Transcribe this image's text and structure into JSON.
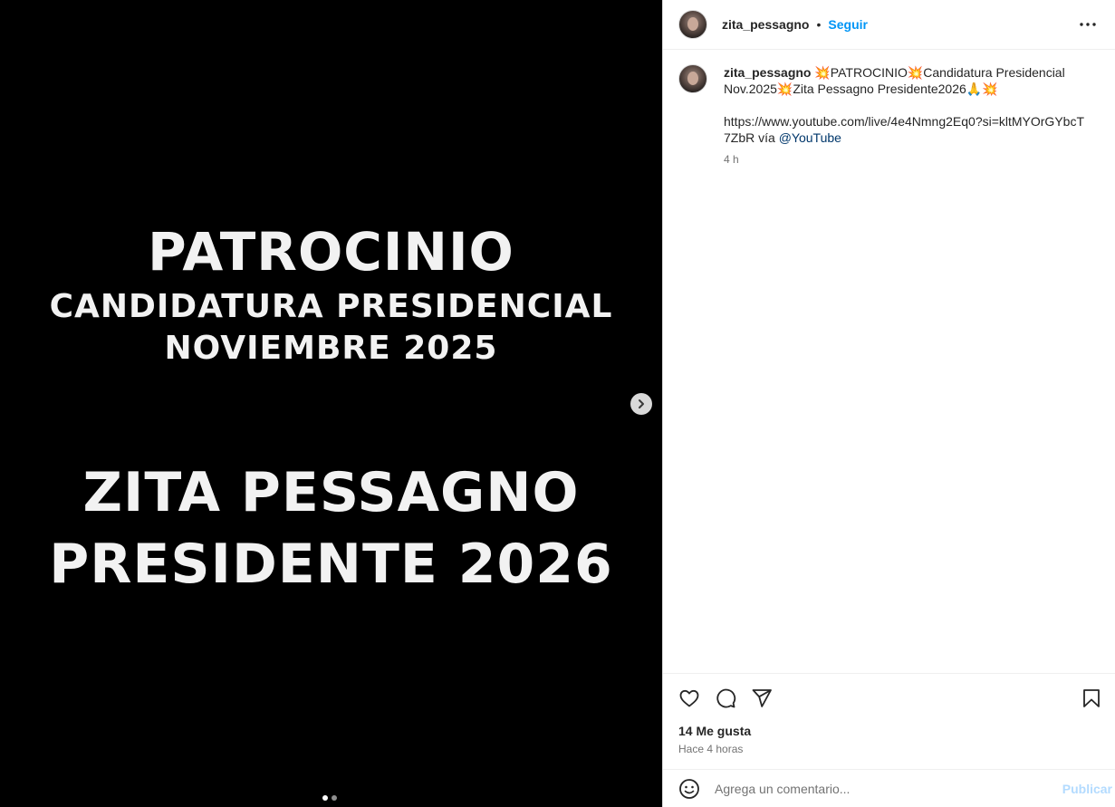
{
  "media": {
    "slide_lines": [
      "PATROCINIO",
      "CANDIDATURA PRESIDENCIAL",
      "NOVIEMBRE 2025",
      "ZITA PESSAGNO",
      "PRESIDENTE 2026"
    ],
    "slide_count": 2,
    "active_slide": 1
  },
  "header": {
    "username": "zita_pessagno",
    "separator": "•",
    "follow_label": "Seguir"
  },
  "caption": {
    "username": "zita_pessagno",
    "text_line1": "💥PATROCINIO💥Candidatura Presidencial Nov.2025💥Zita Pessagno Presidente2026🙏💥",
    "link": "https://www.youtube.com/live/4e4Nmng2Eq0?si=kltMYOrGYbcT7ZbR",
    "via": "vía",
    "mention": "@YouTube",
    "time": "4 h"
  },
  "actions": {
    "likes": "14 Me gusta",
    "posted": "Hace 4 horas"
  },
  "comment_box": {
    "placeholder": "Agrega un comentario...",
    "publish_label": "Publicar"
  },
  "colors": {
    "accent": "#0095f6",
    "publish_disabled": "#b3dbff",
    "media_background": "#000000"
  }
}
